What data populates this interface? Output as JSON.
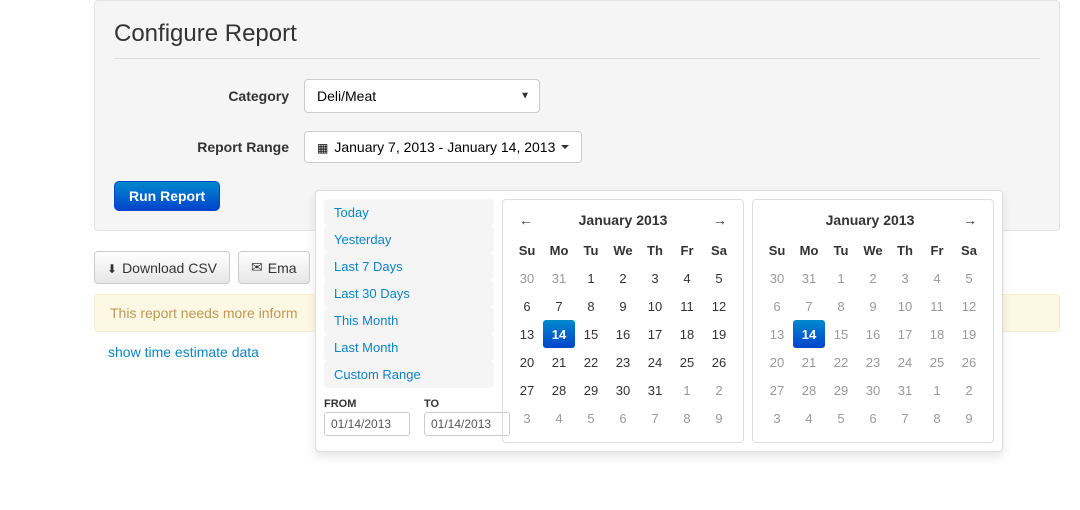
{
  "panel": {
    "title": "Configure Report",
    "category_label": "Category",
    "category_value": "Deli/Meat",
    "range_label": "Report Range",
    "range_value": "January 7, 2013 - January 14, 2013",
    "run_label": "Run Report"
  },
  "actions": {
    "download": "Download CSV",
    "email": "Ema"
  },
  "alert": {
    "text": "This report needs more inform"
  },
  "link": {
    "text": "show time estimate data"
  },
  "picker": {
    "ranges": [
      "Today",
      "Yesterday",
      "Last 7 Days",
      "Last 30 Days",
      "This Month",
      "Last Month",
      "Custom Range"
    ],
    "from_label": "FROM",
    "to_label": "TO",
    "from_value": "01/14/2013",
    "to_value": "01/14/2013",
    "left": {
      "title": "January 2013",
      "dow": [
        "Su",
        "Mo",
        "Tu",
        "We",
        "Th",
        "Fr",
        "Sa"
      ],
      "weeks": [
        [
          {
            "d": 30,
            "off": true
          },
          {
            "d": 31,
            "off": true
          },
          {
            "d": 1
          },
          {
            "d": 2
          },
          {
            "d": 3
          },
          {
            "d": 4
          },
          {
            "d": 5
          }
        ],
        [
          {
            "d": 6
          },
          {
            "d": 7
          },
          {
            "d": 8
          },
          {
            "d": 9
          },
          {
            "d": 10
          },
          {
            "d": 11
          },
          {
            "d": 12
          }
        ],
        [
          {
            "d": 13
          },
          {
            "d": 14,
            "active": true
          },
          {
            "d": 15
          },
          {
            "d": 16
          },
          {
            "d": 17
          },
          {
            "d": 18
          },
          {
            "d": 19
          }
        ],
        [
          {
            "d": 20
          },
          {
            "d": 21
          },
          {
            "d": 22
          },
          {
            "d": 23
          },
          {
            "d": 24
          },
          {
            "d": 25
          },
          {
            "d": 26
          }
        ],
        [
          {
            "d": 27
          },
          {
            "d": 28
          },
          {
            "d": 29
          },
          {
            "d": 30
          },
          {
            "d": 31
          },
          {
            "d": 1,
            "off": true
          },
          {
            "d": 2,
            "off": true
          }
        ],
        [
          {
            "d": 3,
            "off": true
          },
          {
            "d": 4,
            "off": true
          },
          {
            "d": 5,
            "off": true
          },
          {
            "d": 6,
            "off": true
          },
          {
            "d": 7,
            "off": true
          },
          {
            "d": 8,
            "off": true
          },
          {
            "d": 9,
            "off": true
          }
        ]
      ]
    },
    "right": {
      "title": "January 2013",
      "dow": [
        "Su",
        "Mo",
        "Tu",
        "We",
        "Th",
        "Fr",
        "Sa"
      ],
      "weeks": [
        [
          {
            "d": 30,
            "off": true
          },
          {
            "d": 31,
            "off": true
          },
          {
            "d": 1
          },
          {
            "d": 2
          },
          {
            "d": 3
          },
          {
            "d": 4
          },
          {
            "d": 5
          }
        ],
        [
          {
            "d": 6
          },
          {
            "d": 7
          },
          {
            "d": 8
          },
          {
            "d": 9
          },
          {
            "d": 10
          },
          {
            "d": 11
          },
          {
            "d": 12
          }
        ],
        [
          {
            "d": 13
          },
          {
            "d": 14,
            "active": true
          },
          {
            "d": 15
          },
          {
            "d": 16
          },
          {
            "d": 17
          },
          {
            "d": 18
          },
          {
            "d": 19
          }
        ],
        [
          {
            "d": 20
          },
          {
            "d": 21
          },
          {
            "d": 22
          },
          {
            "d": 23
          },
          {
            "d": 24
          },
          {
            "d": 25
          },
          {
            "d": 26
          }
        ],
        [
          {
            "d": 27
          },
          {
            "d": 28
          },
          {
            "d": 29
          },
          {
            "d": 30
          },
          {
            "d": 31
          },
          {
            "d": 1,
            "off": true
          },
          {
            "d": 2,
            "off": true
          }
        ],
        [
          {
            "d": 3,
            "off": true
          },
          {
            "d": 4,
            "off": true
          },
          {
            "d": 5,
            "off": true
          },
          {
            "d": 6,
            "off": true
          },
          {
            "d": 7,
            "off": true
          },
          {
            "d": 8,
            "off": true
          },
          {
            "d": 9,
            "off": true
          }
        ]
      ]
    }
  }
}
